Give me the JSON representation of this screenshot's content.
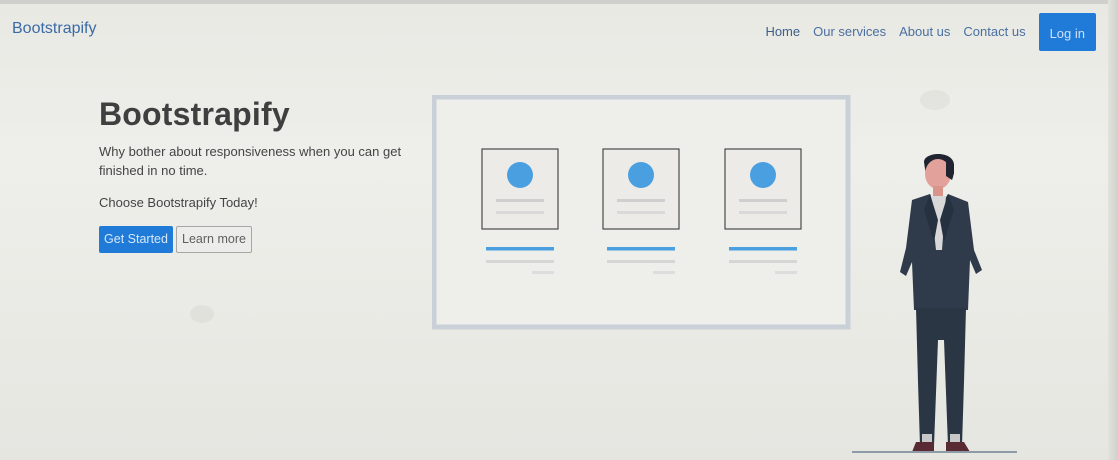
{
  "navbar": {
    "brand": "Bootstrapify",
    "links": [
      {
        "label": "Home"
      },
      {
        "label": "Our services"
      },
      {
        "label": "About us"
      },
      {
        "label": "Contact us"
      }
    ],
    "login_label": "Log in"
  },
  "hero": {
    "title": "Bootstrapify",
    "subtitle": "Why bother about responsiveness when you can get finished in no time.",
    "choose": "Choose Bootstrapify Today!",
    "primary_button": "Get Started",
    "secondary_button": "Learn more"
  },
  "illustration": {
    "card_count": 3,
    "icons": [
      "profile-card-icon",
      "person-standing-icon"
    ]
  },
  "colors": {
    "accent": "#1f7ad8",
    "brand_text": "#3a6aa6",
    "dot_blue": "#4a9fe0",
    "frame": "#c9d0d8",
    "suit": "#2f3b4a"
  }
}
